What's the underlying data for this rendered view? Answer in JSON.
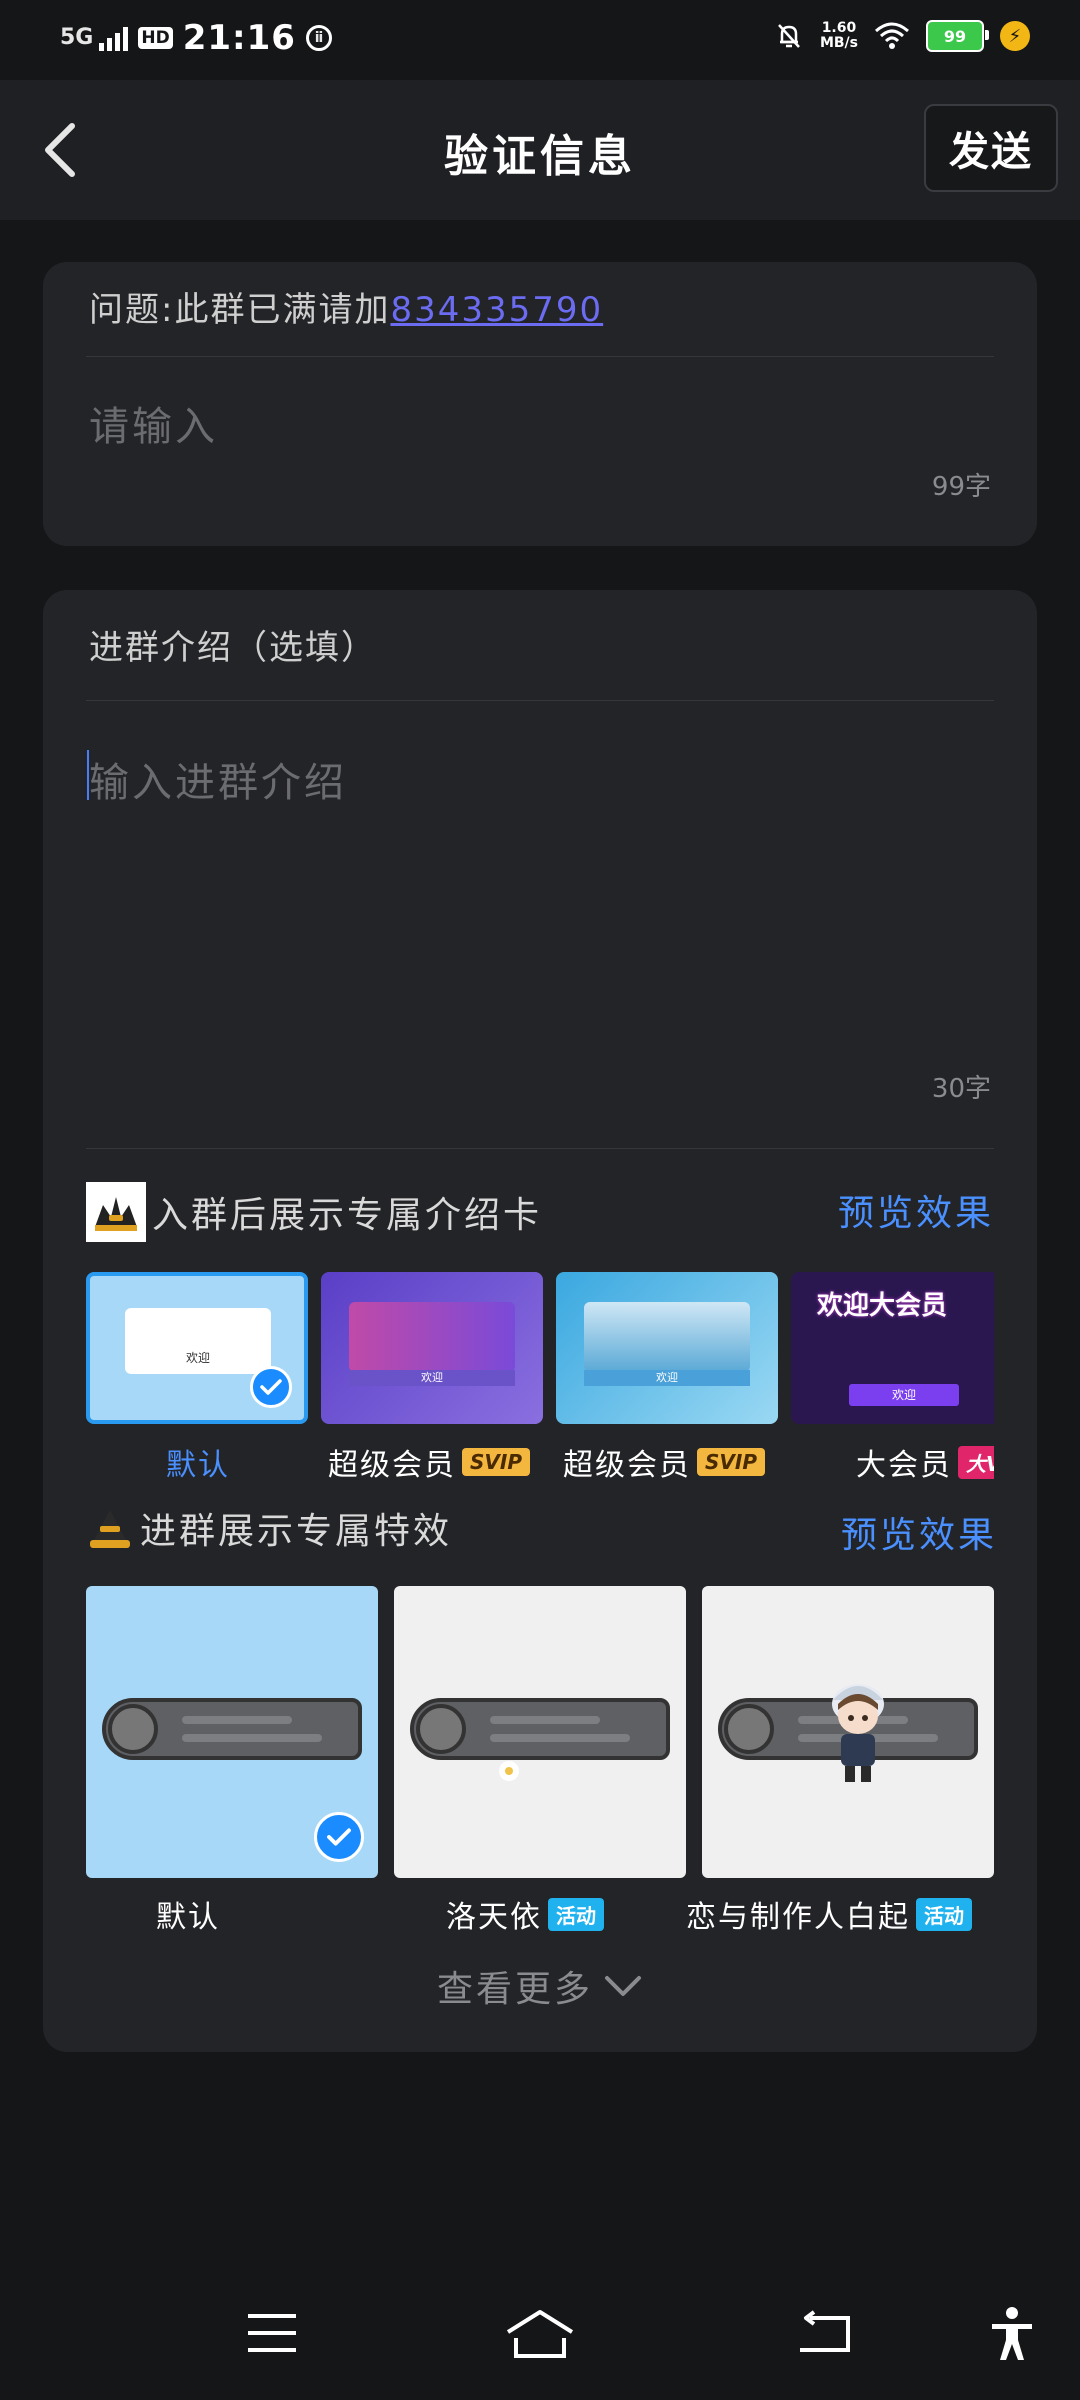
{
  "status_bar": {
    "network": "5G",
    "hd": "HD",
    "time": "21:16",
    "speed": "1.60",
    "speed_unit": "MB/s",
    "battery": "99"
  },
  "header": {
    "title": "验证信息",
    "send_label": "发送"
  },
  "question_card": {
    "prefix": "问题:此群已满请加",
    "link": "834335790",
    "placeholder": "请输入",
    "count": "99字"
  },
  "intro_card": {
    "label": "进群介绍（选填）",
    "placeholder": "输入进群介绍",
    "count": "30字"
  },
  "intro_cards": {
    "title": "入群后展示专属介绍卡",
    "preview": "预览效果",
    "items": [
      {
        "label": "默认",
        "tag": "",
        "selected": true,
        "thumb_text": "欢迎"
      },
      {
        "label": "超级会员",
        "tag": "SVIP",
        "thumb_text": "欢迎"
      },
      {
        "label": "超级会员",
        "tag": "SVIP",
        "thumb_text": "欢迎"
      },
      {
        "label": "大会员",
        "tag": "大VIP",
        "thumb_text": "欢迎大会员",
        "btn_text": "欢迎"
      }
    ]
  },
  "effects": {
    "title": "进群展示专属特效",
    "preview": "预览效果",
    "items": [
      {
        "label": "默认",
        "tag": "",
        "selected": true
      },
      {
        "label": "洛天依",
        "tag": "活动"
      },
      {
        "label": "恋与制作人白起",
        "tag": "活动"
      }
    ],
    "more": "查看更多"
  },
  "colors": {
    "accent": "#4a90ff",
    "link": "#6b6cf2",
    "card_bg": "#232427",
    "page_bg": "#151618"
  }
}
